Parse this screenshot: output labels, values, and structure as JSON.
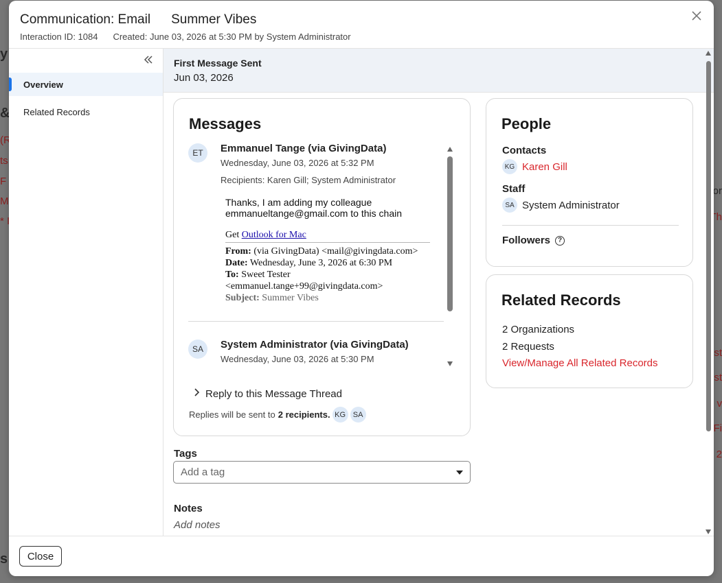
{
  "background_fragments": {
    "left_items": [
      "y",
      "&",
      "(R",
      "ts",
      "F",
      "Mo",
      "* I",
      "s"
    ],
    "right_items": [
      "or",
      "Th",
      "est",
      "est",
      "v",
      "Fi",
      "2"
    ]
  },
  "modal": {
    "title": "Communication: Email",
    "subject": "Summer Vibes",
    "interaction_id": "Interaction ID: 1084",
    "created": "Created: June 03, 2026 at 5:30 PM by System Administrator",
    "close_icon": "close-icon"
  },
  "sidebar": {
    "collapse_icon": "double-chevron-left-icon",
    "items": [
      {
        "label": "Overview",
        "active": true
      },
      {
        "label": "Related Records",
        "active": false
      }
    ]
  },
  "banner": {
    "label": "First Message Sent",
    "value": "Jun 03, 2026"
  },
  "messages": {
    "heading": "Messages",
    "items": [
      {
        "initials": "ET",
        "from": "Emmanuel Tange (via GivingData)",
        "date": "Wednesday, June 03, 2026 at 5:32 PM",
        "recipients": "Recipients: Karen Gill; System Administrator",
        "body_line1": "Thanks, I am adding my colleague emmanueltange@gmail.com to this chain",
        "get_prefix": "Get ",
        "get_link": "Outlook for Mac",
        "quoted_from_label": "From:",
        "quoted_from": " (via GivingData) <mail@givingdata.com>",
        "quoted_date_label": "Date:",
        "quoted_date": " Wednesday, June 3, 2026 at 6:30 PM",
        "quoted_to_label": "To:",
        "quoted_to": " Sweet Tester <emmanuel.tange+99@givingdata.com>",
        "quoted_subject_label": "Subject:",
        "quoted_subject": " Summer Vibes"
      },
      {
        "initials": "SA",
        "from": "System Administrator (via GivingData)",
        "date": "Wednesday, June 03, 2026 at 5:30 PM"
      }
    ],
    "reply_toggle": "Reply to this Message Thread",
    "reply_note_prefix": "Replies will be sent to",
    "reply_note_count": "2 recipients.",
    "reply_avatars": [
      "KG",
      "SA"
    ]
  },
  "tags": {
    "label": "Tags",
    "placeholder": "Add a tag"
  },
  "notes": {
    "label": "Notes",
    "placeholder": "Add notes"
  },
  "people": {
    "heading": "People",
    "contacts_label": "Contacts",
    "contact": {
      "initials": "KG",
      "name": "Karen Gill"
    },
    "staff_label": "Staff",
    "staff": {
      "initials": "SA",
      "name": "System Administrator"
    },
    "followers_label": "Followers",
    "help_icon": "help-circle-icon"
  },
  "related": {
    "heading": "Related Records",
    "organizations": "2 Organizations",
    "requests": "2 Requests",
    "manage_link": "View/Manage All Related Records"
  },
  "footer": {
    "close_label": "Close"
  },
  "colors": {
    "accent_red": "#d9262c",
    "active_blue": "#1a73e8",
    "avatar_bg": "#dde9f7"
  }
}
